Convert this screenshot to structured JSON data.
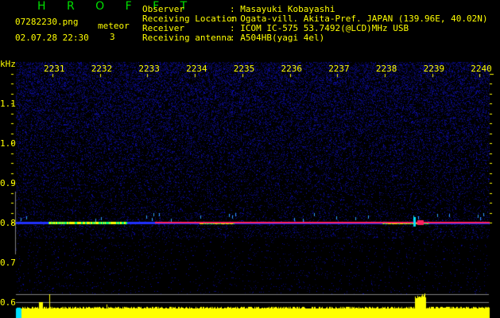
{
  "app_title": "H R O F F T",
  "file_name": "07282230.png",
  "datetime": "02.07.28 22:30",
  "meteor_label": "meteor",
  "meteor_count": "3",
  "info": [
    {
      "label": "Observer",
      "value": ": Masayuki Kobayashi"
    },
    {
      "label": "Receiving Location",
      "value": ": Ogata-vill. Akita-Pref. JAPAN (139.96E, 40.02N)"
    },
    {
      "label": "Receiver",
      "value": ": ICOM IC-575 53.7492(@LCD)MHz USB"
    },
    {
      "label": "Receiving antenna",
      "value": ": A504HB(yagi 4el)"
    }
  ],
  "y_unit": "kHz",
  "y_ticks": [
    "1.1",
    "1.0",
    "0.9",
    "0.8",
    "0.7",
    "0.6"
  ],
  "time_ticks": [
    "2231",
    "2232",
    "2233",
    "2234",
    "2235",
    "2236",
    "2237",
    "2238",
    "2239",
    "2240"
  ],
  "colors": {
    "title": "#00e000",
    "text": "#ffff00",
    "noise": "#1a1aa0",
    "carrier": "#ff2060",
    "histogram": "#ffff00",
    "reference": "#808080"
  }
}
